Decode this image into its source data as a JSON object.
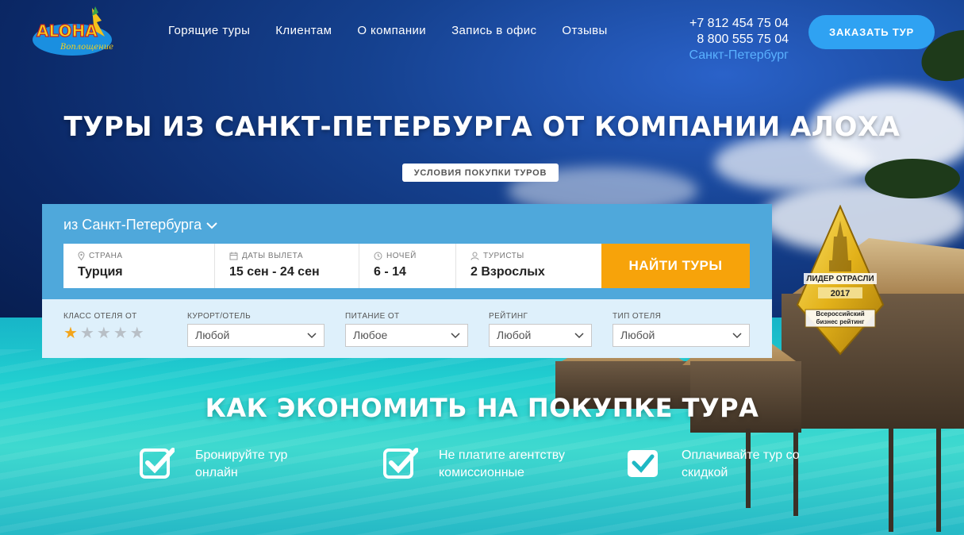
{
  "header": {
    "logo_text": "ALOHA",
    "logo_tagline": "Воплощение мечты",
    "nav": [
      "Горящие туры",
      "Клиентам",
      "О компании",
      "Запись в офис",
      "Отзывы"
    ],
    "phone1": "+7 812 454 75 04",
    "phone2": "8 800 555 75 04",
    "city": "Санкт-Петербург",
    "order_button": "ЗАКАЗАТЬ ТУР"
  },
  "hero": {
    "title": "ТУРЫ ИЗ САНКТ-ПЕТЕРБУРГА ОТ КОМПАНИИ АЛОХА",
    "terms_button": "УСЛОВИЯ ПОКУПКИ ТУРОВ"
  },
  "search": {
    "from": "из Санкт-Петербурга",
    "fields": [
      {
        "label": "СТРАНА",
        "value": "Турция",
        "icon": "map-pin-icon"
      },
      {
        "label": "ДАТЫ ВЫЛЕТА",
        "value": "15 сен - 24 сен",
        "icon": "calendar-icon"
      },
      {
        "label": "НОЧЕЙ",
        "value": "6 - 14",
        "icon": "clock-icon"
      },
      {
        "label": "ТУРИСТЫ",
        "value": "2 Взрослых",
        "icon": "user-icon"
      }
    ],
    "find_button": "НАЙТИ ТУРЫ"
  },
  "filters": {
    "hotel_class_label": "КЛАСС ОТЕЛЯ ОТ",
    "hotel_class_rating": 1,
    "hotel_class_max": 5,
    "resort_label": "КУРОРТ/ОТЕЛЬ",
    "resort_value": "Любой",
    "meal_label": "ПИТАНИЕ ОТ",
    "meal_value": "Любое",
    "rating_label": "РЕЙТИНГ",
    "rating_value": "Любой",
    "type_label": "ТИП ОТЕЛЯ",
    "type_value": "Любой"
  },
  "badge": {
    "title": "ЛИДЕР ОТРАСЛИ",
    "year": "2017",
    "line1": "Всероссийский",
    "line2": "бизнес рейтинг"
  },
  "savings": {
    "title": "КАК ЭКОНОМИТЬ НА ПОКУПКЕ ТУРА",
    "tips": [
      {
        "line1": "Бронируйте тур",
        "line2": "онлайн"
      },
      {
        "line1": "Не платите агентству",
        "line2": "комиссионные"
      },
      {
        "line1": "Оплачивайте тур со",
        "line2": "скидкой"
      }
    ]
  },
  "colors": {
    "accent_blue": "#2fa2f2",
    "search_panel": "#4fa8db",
    "find_button": "#f7a30a",
    "city_link": "#5ab1ff",
    "star_active": "#f3a51b"
  }
}
